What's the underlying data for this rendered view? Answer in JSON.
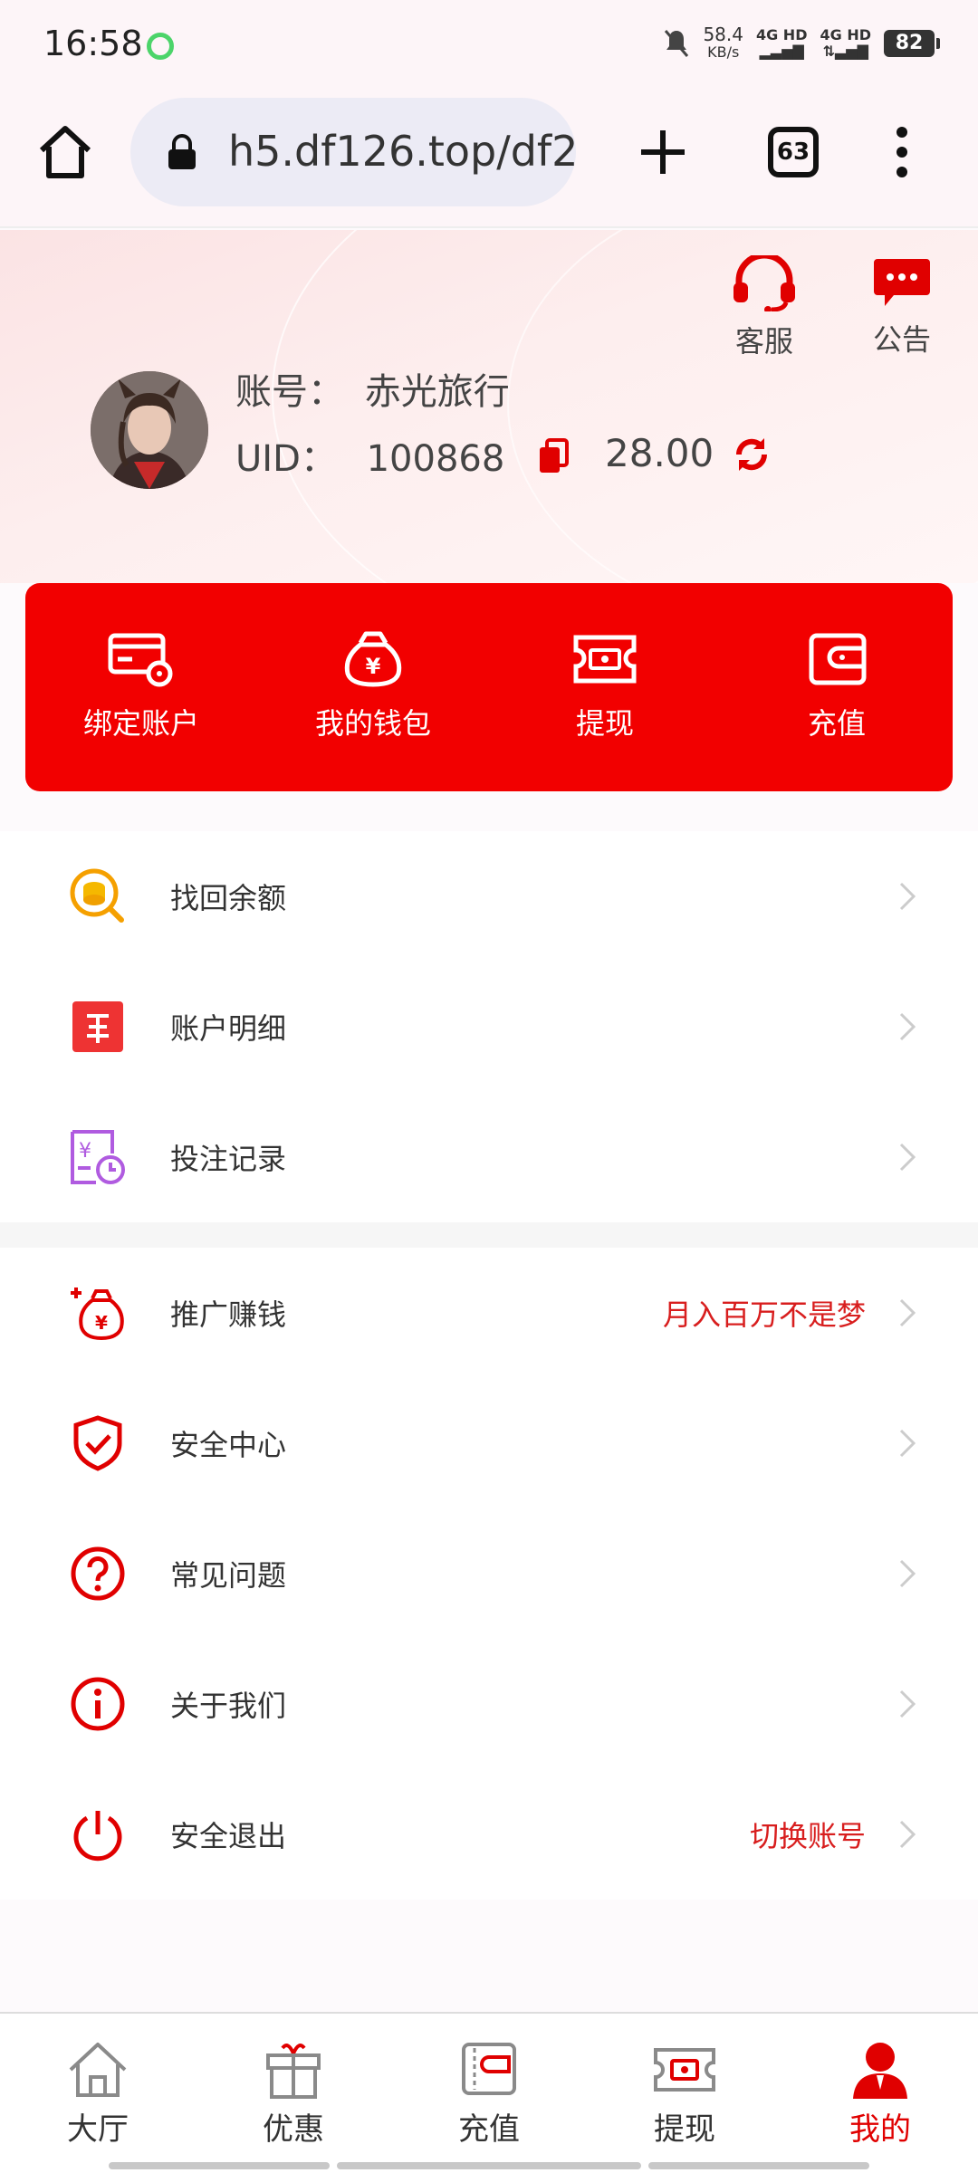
{
  "status_bar": {
    "time": "16:58",
    "net_speed_value": "58.4",
    "net_speed_unit": "KB/s",
    "signal_1": "4G HD",
    "signal_2": "4G HD",
    "battery": "82"
  },
  "browser": {
    "url": "h5.df126.top/df2",
    "tab_count": "63"
  },
  "header": {
    "service_label": "客服",
    "notice_label": "公告",
    "account_label": "账号：",
    "account_name": "赤光旅行",
    "uid_label": "UID：",
    "uid_value": "100868",
    "balance": "28.00"
  },
  "quick_actions": [
    {
      "label": "绑定账户",
      "icon": "card-settings-icon"
    },
    {
      "label": "我的钱包",
      "icon": "money-bag-icon"
    },
    {
      "label": "提现",
      "icon": "ticket-cash-icon"
    },
    {
      "label": "充值",
      "icon": "wallet-icon"
    }
  ],
  "menu_group_1": [
    {
      "label": "找回余额",
      "icon": "coin-search-icon"
    },
    {
      "label": "账户明细",
      "icon": "yen-doc-icon"
    },
    {
      "label": "投注记录",
      "icon": "bet-record-icon"
    }
  ],
  "menu_group_2": [
    {
      "label": "推广赚钱",
      "extra": "月入百万不是梦",
      "icon": "promo-bag-icon"
    },
    {
      "label": "安全中心",
      "extra": "",
      "icon": "shield-check-icon"
    },
    {
      "label": "常见问题",
      "extra": "",
      "icon": "question-icon"
    },
    {
      "label": "关于我们",
      "extra": "",
      "icon": "info-icon"
    },
    {
      "label": "安全退出",
      "extra": "切换账号",
      "icon": "power-icon"
    }
  ],
  "bottom_nav": [
    {
      "label": "大厅",
      "icon": "home-icon",
      "active": false
    },
    {
      "label": "优惠",
      "icon": "gift-icon",
      "active": false
    },
    {
      "label": "充值",
      "icon": "wallet-icon",
      "active": false
    },
    {
      "label": "提现",
      "icon": "ticket-cash-icon",
      "active": false
    },
    {
      "label": "我的",
      "icon": "user-icon",
      "active": true
    }
  ],
  "colors": {
    "primary_red": "#f20000",
    "accent_red": "#d81e1e",
    "status_green": "#4cd46a"
  }
}
